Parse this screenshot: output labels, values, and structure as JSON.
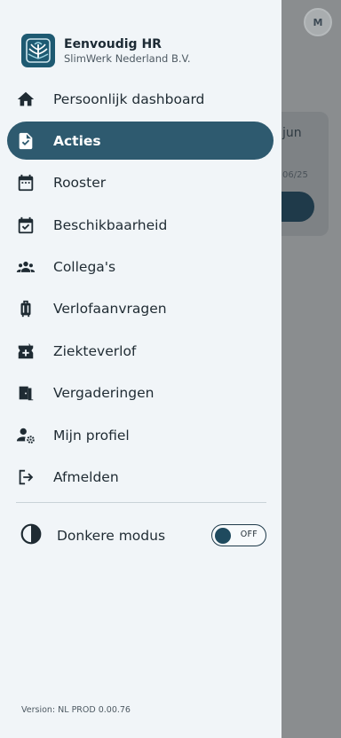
{
  "background": {
    "avatar_initial": "M",
    "card_title": "jun",
    "card_date": "06/25"
  },
  "brand": {
    "title": "Eenvoudig HR",
    "subtitle": "SlimWerk Nederland B.V."
  },
  "nav": {
    "items": [
      {
        "label": "Persoonlijk dashboard",
        "icon": "home-icon",
        "active": false
      },
      {
        "label": "Acties",
        "icon": "document-check-icon",
        "active": true
      },
      {
        "label": "Rooster",
        "icon": "calendar-icon",
        "active": false
      },
      {
        "label": "Beschikbaarheid",
        "icon": "calendar-check-icon",
        "active": false
      },
      {
        "label": "Collega's",
        "icon": "people-icon",
        "active": false
      },
      {
        "label": "Verlofaanvragen",
        "icon": "suitcase-icon",
        "active": false
      },
      {
        "label": "Ziekteverlof",
        "icon": "medical-bag-icon",
        "active": false
      },
      {
        "label": "Vergaderingen",
        "icon": "door-icon",
        "active": false
      },
      {
        "label": "Mijn profiel",
        "icon": "user-settings-icon",
        "active": false
      },
      {
        "label": "Afmelden",
        "icon": "logout-icon",
        "active": false
      }
    ]
  },
  "dark_mode": {
    "label": "Donkere modus",
    "state": "OFF",
    "icon": "contrast-icon"
  },
  "version": "Version: NL PROD 0.00.76",
  "colors": {
    "accent": "#2e5a6f",
    "drawer_bg": "#f1f5f8",
    "text": "#1f2b33"
  }
}
